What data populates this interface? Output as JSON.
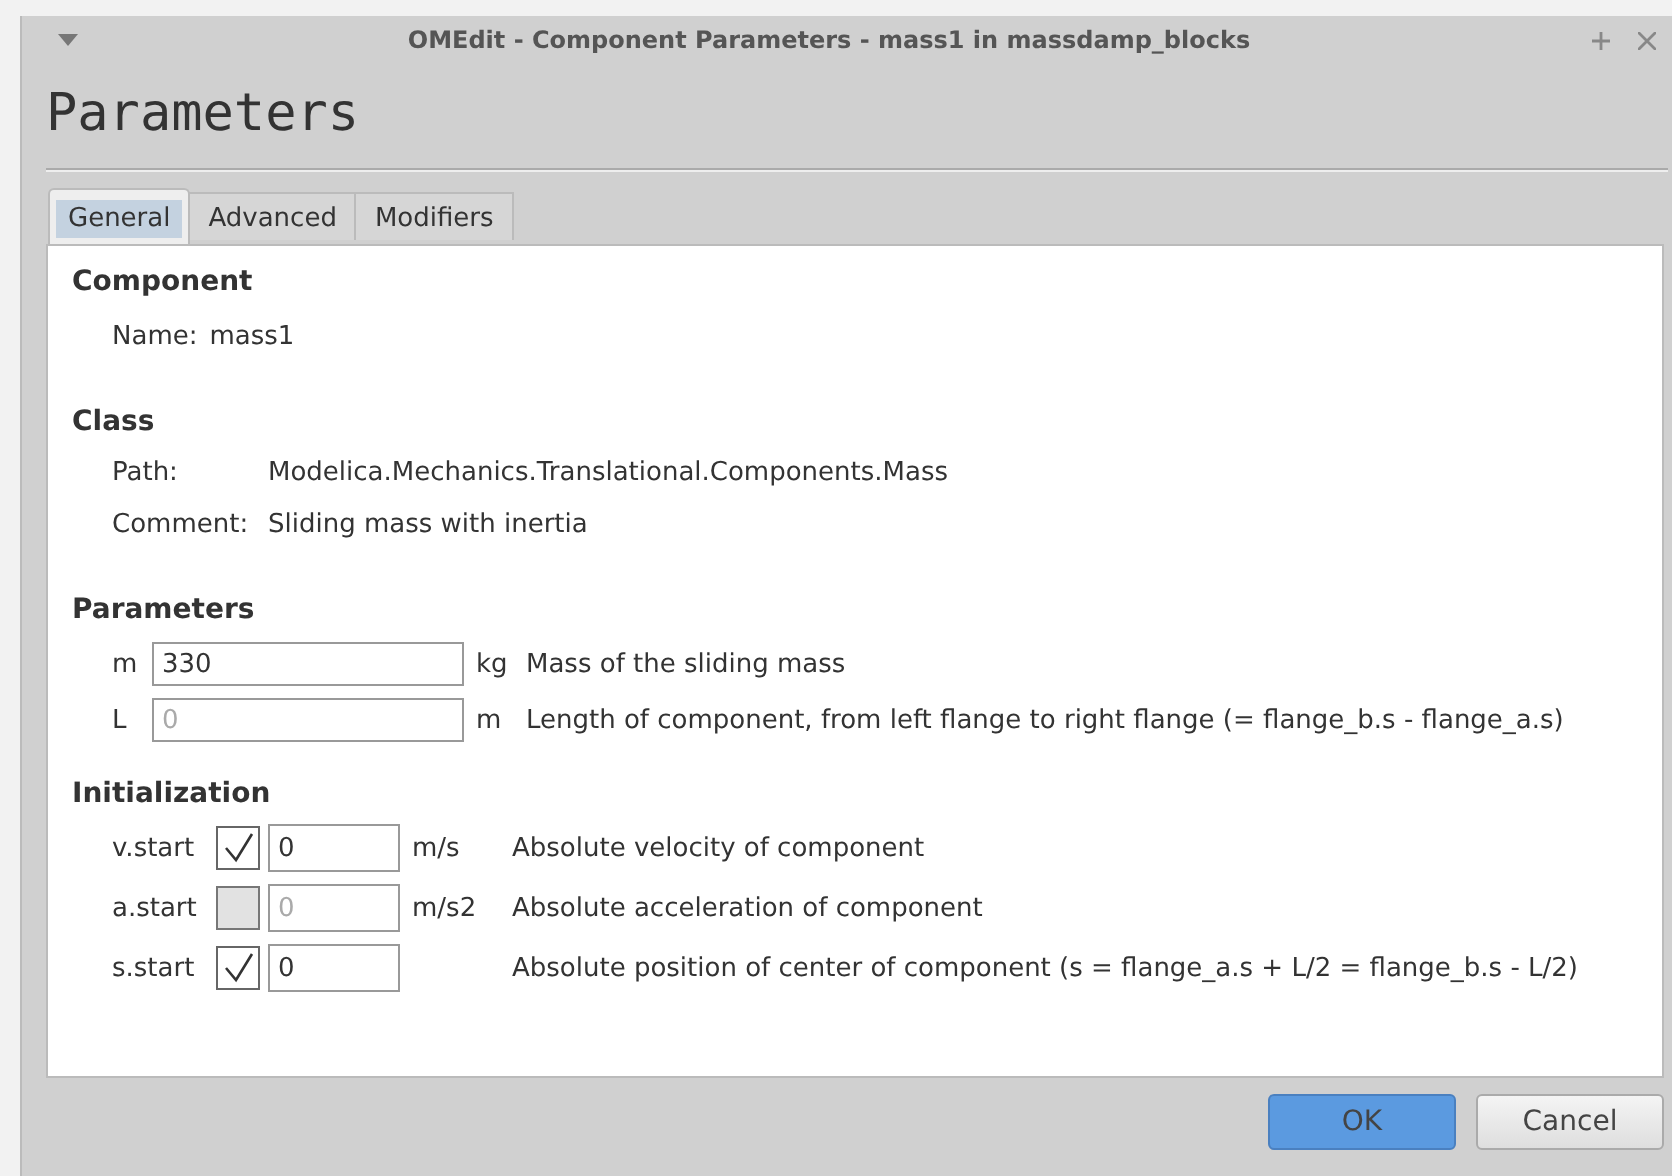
{
  "window": {
    "title": "OMEdit - Component Parameters - mass1 in massdamp_blocks"
  },
  "heading": "Parameters",
  "tabs": [
    {
      "label": "General",
      "selected": true
    },
    {
      "label": "Advanced",
      "selected": false
    },
    {
      "label": "Modifiers",
      "selected": false
    }
  ],
  "component": {
    "title": "Component",
    "name_label": "Name:",
    "name": "mass1"
  },
  "class": {
    "title": "Class",
    "rows": [
      {
        "label": "Path:",
        "value": "Modelica.Mechanics.Translational.Components.Mass"
      },
      {
        "label": "Comment:",
        "value": "Sliding mass with inertia"
      }
    ]
  },
  "parameters": {
    "title": "Parameters",
    "rows": [
      {
        "name": "m",
        "value": "330",
        "unit": "kg",
        "description": "Mass of the sliding mass"
      },
      {
        "name": "L",
        "placeholder": "0",
        "unit": "m",
        "description": "Length of component, from left flange to right flange (= flange_b.s - flange_a.s)"
      }
    ]
  },
  "initialization": {
    "title": "Initialization",
    "rows": [
      {
        "name": "v.start",
        "checked": true,
        "value": "0",
        "unit": "m/s",
        "description": "Absolute velocity of component"
      },
      {
        "name": "a.start",
        "checked": false,
        "placeholder": "0",
        "unit": "m/s2",
        "description": "Absolute acceleration of component"
      },
      {
        "name": "s.start",
        "checked": true,
        "value": "0",
        "description": "Absolute position of center of component (s = flange_a.s + L/2 = flange_b.s - L/2)"
      }
    ]
  },
  "buttons": [
    {
      "label": "OK",
      "kind": "primary"
    },
    {
      "label": "Cancel",
      "kind": "normal"
    }
  ]
}
